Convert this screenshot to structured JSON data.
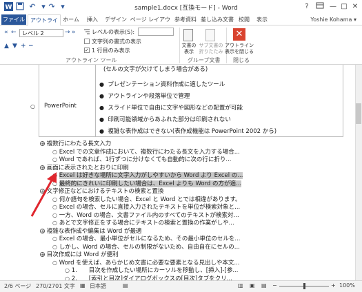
{
  "window": {
    "title": "sample1.docx [互換モード] - Word",
    "help": "?",
    "minimize": "—",
    "maximize": "□",
    "close": "✕"
  },
  "quick_access": {
    "save": "💾",
    "undo": "↶",
    "redo": "↷",
    "customize": "▾"
  },
  "tabs": [
    "ファイル",
    "アウトライン",
    "ホーム",
    "挿入",
    "デザイン",
    "ページ レイアウト",
    "参考資料",
    "差し込み文書",
    "校閲",
    "表示"
  ],
  "user": "Yoshie Kohama ▾",
  "ribbon": {
    "level_label": "レベル 2",
    "show_level_label": "レベルの表示(S):",
    "show_text_format": "文字列の書式の表示",
    "show_first_line": "1 行目のみ表示",
    "first_line_checked": "✓",
    "group_outline_tools": "アウトライン ツール",
    "btn_show_doc": [
      "文書の",
      "表示"
    ],
    "btn_subdoc": [
      "サブ文書の",
      "折りたたみ"
    ],
    "group_master": "グループ文書",
    "btn_close_outline": [
      "アウトライン",
      "表示を閉じる"
    ],
    "group_close": "閉じる"
  },
  "table_rows": [
    "(セルの文字が欠けてしまう場合がある)",
    "プレゼンテーション資料作成に適したツール",
    "アウトラインや段落単位で管理",
    "スライド単位で自由に文字や図形などの配置が可能",
    "印刷可能領域からあふれた部分は印刷されない",
    "複雑な表作成はできない(表作成機能は PowerPoint 2002 から)"
  ],
  "table_cell_label": "PowerPoint",
  "outline": [
    {
      "level": 1,
      "text": "複数行にわたる長文入力"
    },
    {
      "level": 2,
      "text": "Excel での文章作成において、複数行にわたる長文を入力する場合..."
    },
    {
      "level": 2,
      "text": "Word であれば、1行ずつに分けなくても自動的に次の行に折り..."
    },
    {
      "level": 1,
      "text": "画面に表示されたとおりに印刷"
    },
    {
      "level": 2,
      "text": "Excel は好きな場所に文字入力がしやすいから Word より Excel の..."
    },
    {
      "level": 2,
      "text": "最終的にきれいに印刷したい場合は、Excel よりも Word の方が適..."
    },
    {
      "level": 1,
      "text": "文字修正などにおけるテキストの検索と置換"
    },
    {
      "level": 2,
      "text": "何か語句を検索したい場合、Excel と Word とでは相違があります。"
    },
    {
      "level": 2,
      "text": "Excel の場合、セルに直接入力されたテキストを単位が検索対象と..."
    },
    {
      "level": 2,
      "text": "一方、Word の場合、文書ファイル内のすべてのテキストが検索対..."
    },
    {
      "level": 2,
      "text": "あとで文字修正をする場合にテキストの検索と置換の作業がしや..."
    },
    {
      "level": 1,
      "text": "複雑な表作成や編集は Word が最適"
    },
    {
      "level": 2,
      "text": "Excel の場合、最小単位がセルになるため、その最小単位のセルを..."
    },
    {
      "level": 2,
      "text": "しかし、Word の場合、セルの制限がないため、自由自在にセルの..."
    },
    {
      "level": 1,
      "text": "目次作成には Word が便利"
    },
    {
      "level": 2,
      "text": "Word を使えば、あらかじめ文書に必要な要素となる見出しや本文..."
    },
    {
      "level": 3,
      "text": "1.　　目次を作成したい場所にカーソルを移動し、[挿入]-[参..."
    },
    {
      "level": 3,
      "text": "2.　　[索引と目次]ダイアログボックスの[目次]タブをクリ..."
    }
  ],
  "status": {
    "page": "2/6 ページ",
    "words": "270/2701 文字",
    "lang": "日本語",
    "zoom": "100%"
  },
  "colors": {
    "word_blue": "#2b579a",
    "close_red": "#d9432f",
    "arrow_red": "#e0262e",
    "highlight": "#c8c8c8"
  }
}
